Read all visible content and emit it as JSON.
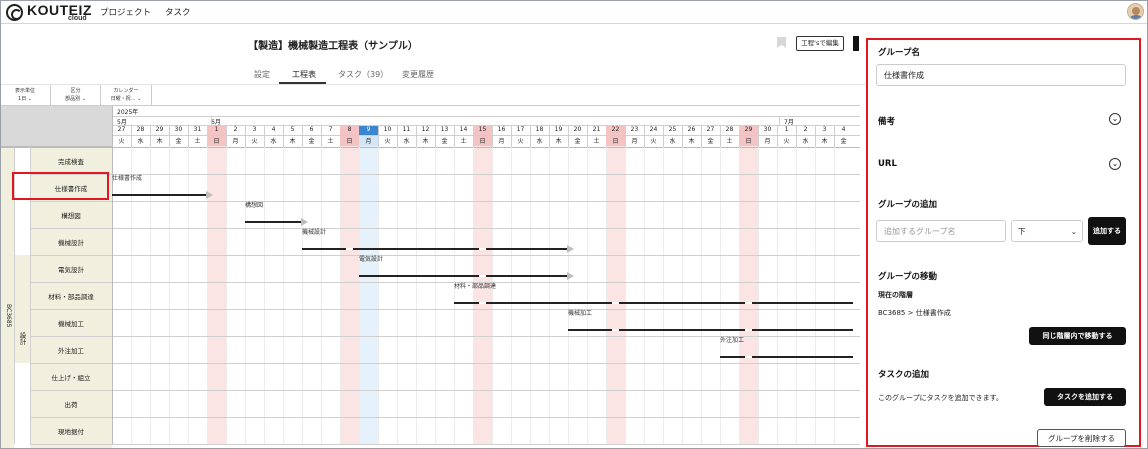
{
  "app": {
    "logo": "KOUTEIZ",
    "logo_sub": "cloud"
  },
  "nav": {
    "project": "プロジェクト",
    "task": "タスク"
  },
  "page": {
    "title": "【製造】機械製造工程表（サンプル）",
    "export_button": "工程'sで編集"
  },
  "tabs": [
    "設定",
    "工程表",
    "タスク（39）",
    "変更履歴"
  ],
  "filters": [
    {
      "label": "表示単位",
      "value": "1日"
    },
    {
      "label": "区分",
      "value": "部品別"
    },
    {
      "label": "カレンダー",
      "value": "日曜・祝…"
    }
  ],
  "gantt": {
    "year": "2025年",
    "month_may": "5月",
    "month_june": "6月",
    "month_july": "7月",
    "days": [
      "27",
      "28",
      "29",
      "30",
      "31",
      "1",
      "2",
      "3",
      "4",
      "5",
      "6",
      "7",
      "8",
      "9",
      "10",
      "11",
      "12",
      "13",
      "14",
      "15",
      "16",
      "17",
      "18",
      "19",
      "20",
      "21",
      "22",
      "23",
      "24",
      "25",
      "26",
      "27",
      "28",
      "29",
      "30",
      "1",
      "2",
      "3",
      "4"
    ],
    "weekdays": [
      "火",
      "水",
      "木",
      "金",
      "土",
      "日",
      "月",
      "火",
      "水",
      "木",
      "金",
      "土",
      "日",
      "月",
      "火",
      "水",
      "木",
      "金",
      "土",
      "日",
      "月",
      "火",
      "水",
      "木",
      "金",
      "土",
      "日",
      "月",
      "火",
      "水",
      "木",
      "金",
      "土",
      "日",
      "月",
      "火",
      "水",
      "木",
      "金"
    ],
    "project_label": "BC3685",
    "group_label": "設計",
    "rows": [
      "完成検査",
      "仕様書作成",
      "構想図",
      "機械設計",
      "電気設計",
      "材料・部品調達",
      "機械加工",
      "外注加工",
      "仕上げ・組立",
      "出荷",
      "現地据付"
    ],
    "bars": [
      {
        "label": "仕様書作成",
        "row": 1,
        "start": 0,
        "end": 5,
        "arrow": true
      },
      {
        "label": "構想図",
        "row": 2,
        "start": 7,
        "end": 10,
        "arrow": true
      },
      {
        "label": "機械設計",
        "row": 3,
        "start": 10,
        "end": 24,
        "arrow": true
      },
      {
        "label": "電気設計",
        "row": 4,
        "start": 13,
        "end": 24,
        "arrow": true
      },
      {
        "label": "材料・部品調達",
        "row": 5,
        "start": 18,
        "end": 39,
        "arrow": false
      },
      {
        "label": "機械加工",
        "row": 6,
        "start": 24,
        "end": 39,
        "arrow": false
      },
      {
        "label": "外注加工",
        "row": 7,
        "start": 32,
        "end": 39,
        "arrow": false
      }
    ]
  },
  "panel": {
    "group_name_heading": "グループ名",
    "group_name_value": "仕様書作成",
    "memo_heading": "備考",
    "url_heading": "URL",
    "add_group_heading": "グループの追加",
    "add_group_placeholder": "追加するグループ名",
    "position_select": "下",
    "add_button": "追加する",
    "move_group_heading": "グループの移動",
    "current_level_label": "現在の階層",
    "current_level_value": "BC3685 > 仕様書作成",
    "move_button": "同じ階層内で移動する",
    "add_task_heading": "タスクの追加",
    "add_task_desc": "このグループにタスクを追加できます。",
    "add_task_button": "タスクを追加する",
    "delete_group_button": "グループを削除する"
  }
}
